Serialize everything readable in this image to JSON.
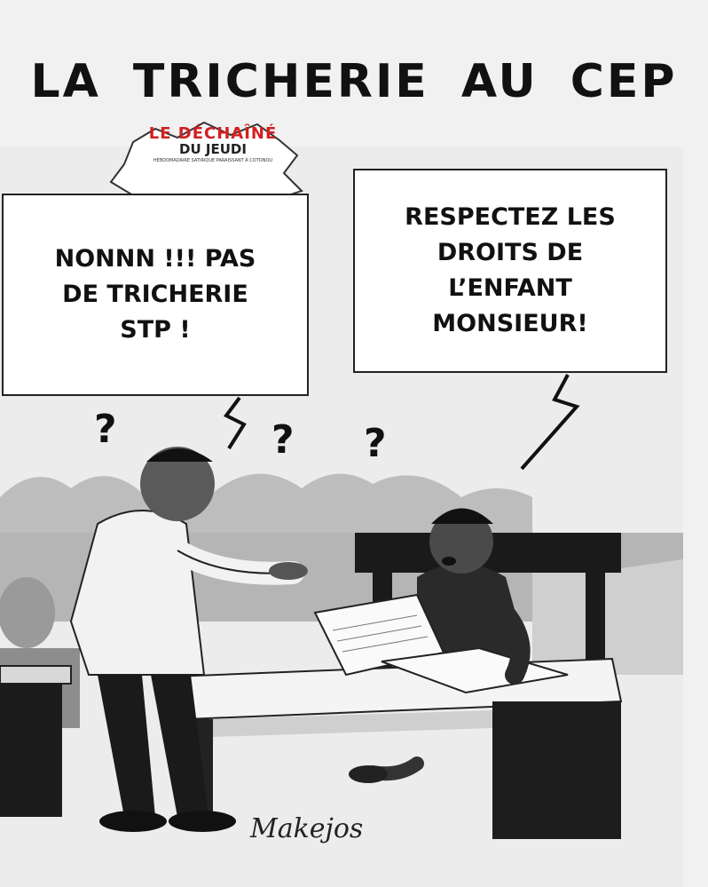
{
  "title_words": [
    "LA",
    "TRICHERIE",
    "AU",
    "CEP"
  ],
  "logo": {
    "name": "LE DÉCHAÎNÉ",
    "subtitle": "DU JEUDI",
    "tagline": "HEBDOMADAIRE SATIRIQUE PARAISSANT À COTONOU"
  },
  "bubbles": {
    "teacher": [
      "NONNN !!! PAS",
      "DE TRICHERIE",
      "STP !"
    ],
    "student": [
      "RESPECTEZ LES",
      "DROITS DE",
      "L’ENFANT",
      "MONSIEUR!"
    ]
  },
  "question_mark": "?",
  "signature": "Makejos"
}
